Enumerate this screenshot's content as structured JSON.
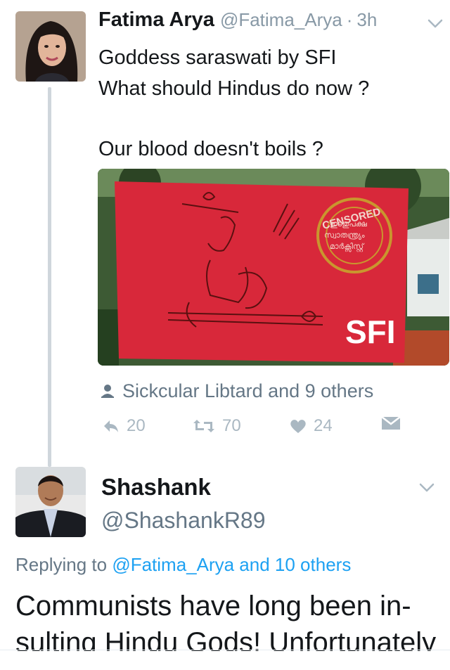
{
  "tweet": {
    "author_name": "Fatima Arya",
    "handle": "@Fatima_Arya",
    "separator": "·",
    "time": "3h",
    "text_lines": [
      "Goddess saraswati by SFI",
      "What should Hindus do now ?",
      "",
      "Our blood doesn't boils ?"
    ],
    "media": {
      "stamp_text": "CENSORED",
      "banner_text": "SFI"
    },
    "liked_by": "Sickcular Libtard and 9 others",
    "actions": {
      "reply_count": "20",
      "retweet_count": "70",
      "like_count": "24"
    },
    "icons": [
      "chevron-down-icon",
      "person-icon",
      "reply-icon",
      "retweet-icon",
      "heart-icon",
      "direct-message-icon"
    ]
  },
  "reply": {
    "author_name": "Shashank",
    "handle": "@ShashankR89",
    "replying_prefix": "Replying to",
    "replying_targets": "@Fatima_Arya and 10 others",
    "text_lines": [
      "Communists have long been in-",
      "sulting Hindu Gods! Unfortunately"
    ]
  },
  "colors": {
    "text": "#14171a",
    "secondary": "#657786",
    "muted": "#8899a6",
    "icon_gray": "#aab8c2",
    "link": "#1da1f2",
    "thread_line": "#cfd6dc",
    "banner_red": "#d8283a"
  }
}
